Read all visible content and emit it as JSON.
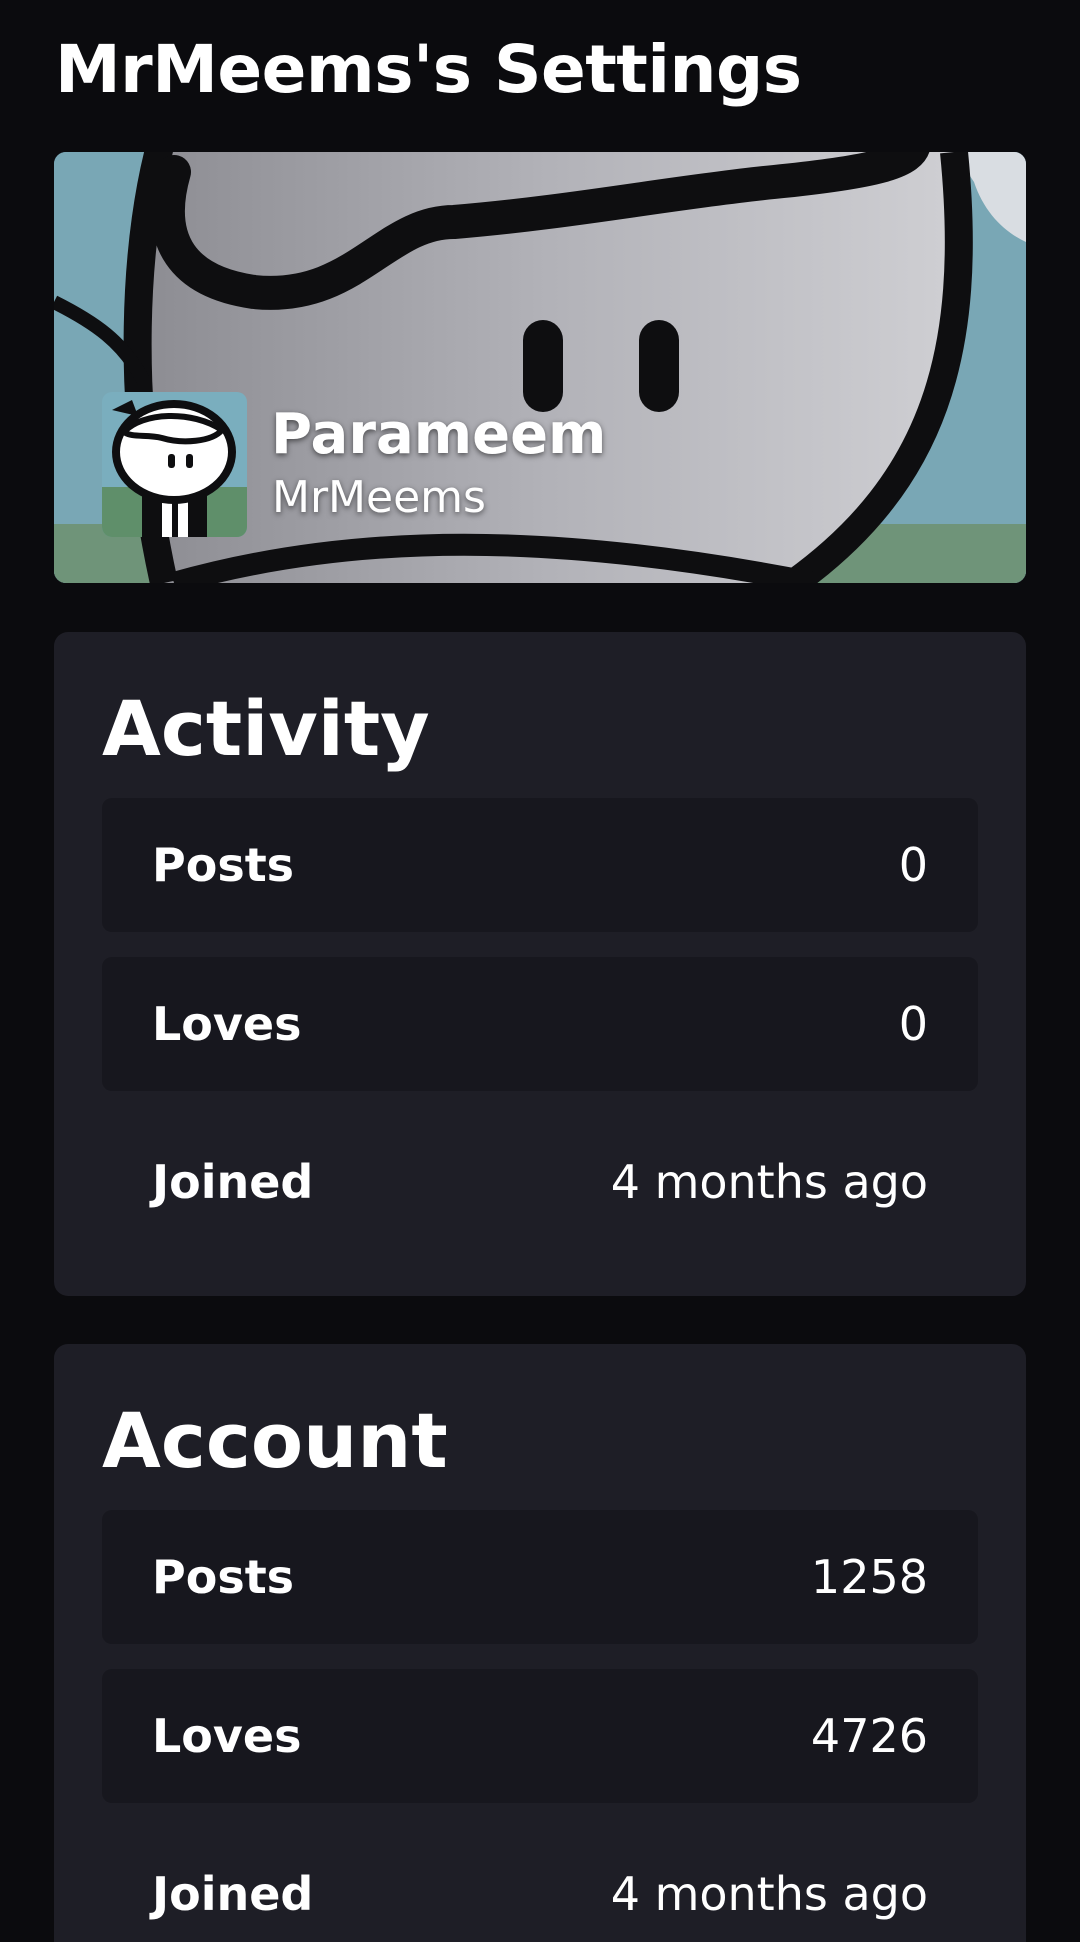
{
  "header": {
    "title": "MrMeems's Settings"
  },
  "profile": {
    "display_name": "Parameem",
    "username": "MrMeems",
    "avatar_icon": "cartoon-avatar",
    "banner_image": "cartoon-character-banner"
  },
  "activity": {
    "title": "Activity",
    "rows": [
      {
        "label": "Posts",
        "value": "0"
      },
      {
        "label": "Loves",
        "value": "0"
      },
      {
        "label": "Joined",
        "value": "4 months ago"
      }
    ]
  },
  "account": {
    "title": "Account",
    "rows": [
      {
        "label": "Posts",
        "value": "1258"
      },
      {
        "label": "Loves",
        "value": "4726"
      },
      {
        "label": "Joined",
        "value": "4 months ago"
      }
    ]
  },
  "colors": {
    "background": "#0b0b0e",
    "card": "#1e1e26",
    "row": "#17171e",
    "text": "#ffffff"
  }
}
